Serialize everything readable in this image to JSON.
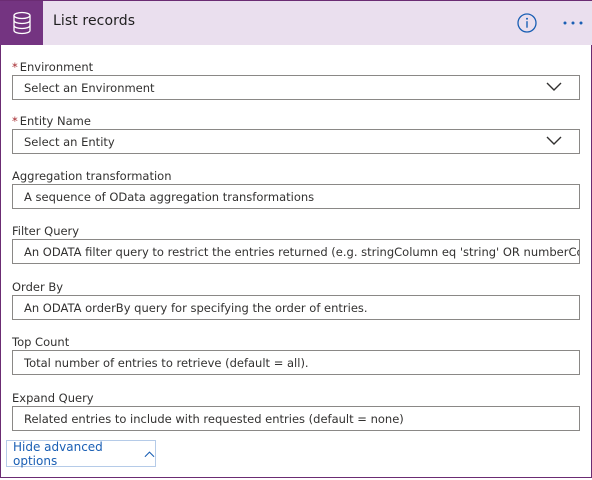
{
  "header": {
    "title": "List records",
    "connector_icon": "database-icon",
    "info_icon": "info-icon",
    "more_icon": "ellipsis-icon",
    "accent": "#743481",
    "header_bg": "#eadfee"
  },
  "fields": {
    "environment": {
      "label": "Environment",
      "required": "*",
      "value": "Select an Environment"
    },
    "entity_name": {
      "label": "Entity Name",
      "required": "*",
      "value": "Select an Entity"
    },
    "aggregation": {
      "label": "Aggregation transformation",
      "placeholder": "A sequence of OData aggregation transformations"
    },
    "filter_query": {
      "label": "Filter Query",
      "placeholder": "An ODATA filter query to restrict the entries returned (e.g. stringColumn eq 'string' OR numberColumn"
    },
    "order_by": {
      "label": "Order By",
      "placeholder": "An ODATA orderBy query for specifying the order of entries."
    },
    "top_count": {
      "label": "Top Count",
      "placeholder": "Total number of entries to retrieve (default = all)."
    },
    "expand_query": {
      "label": "Expand Query",
      "placeholder": "Related entries to include with requested entries (default = none)"
    }
  },
  "footer": {
    "advanced_label": "Hide advanced options",
    "advanced_icon": "chevron-up-icon",
    "link_color": "#1a5fb4"
  }
}
